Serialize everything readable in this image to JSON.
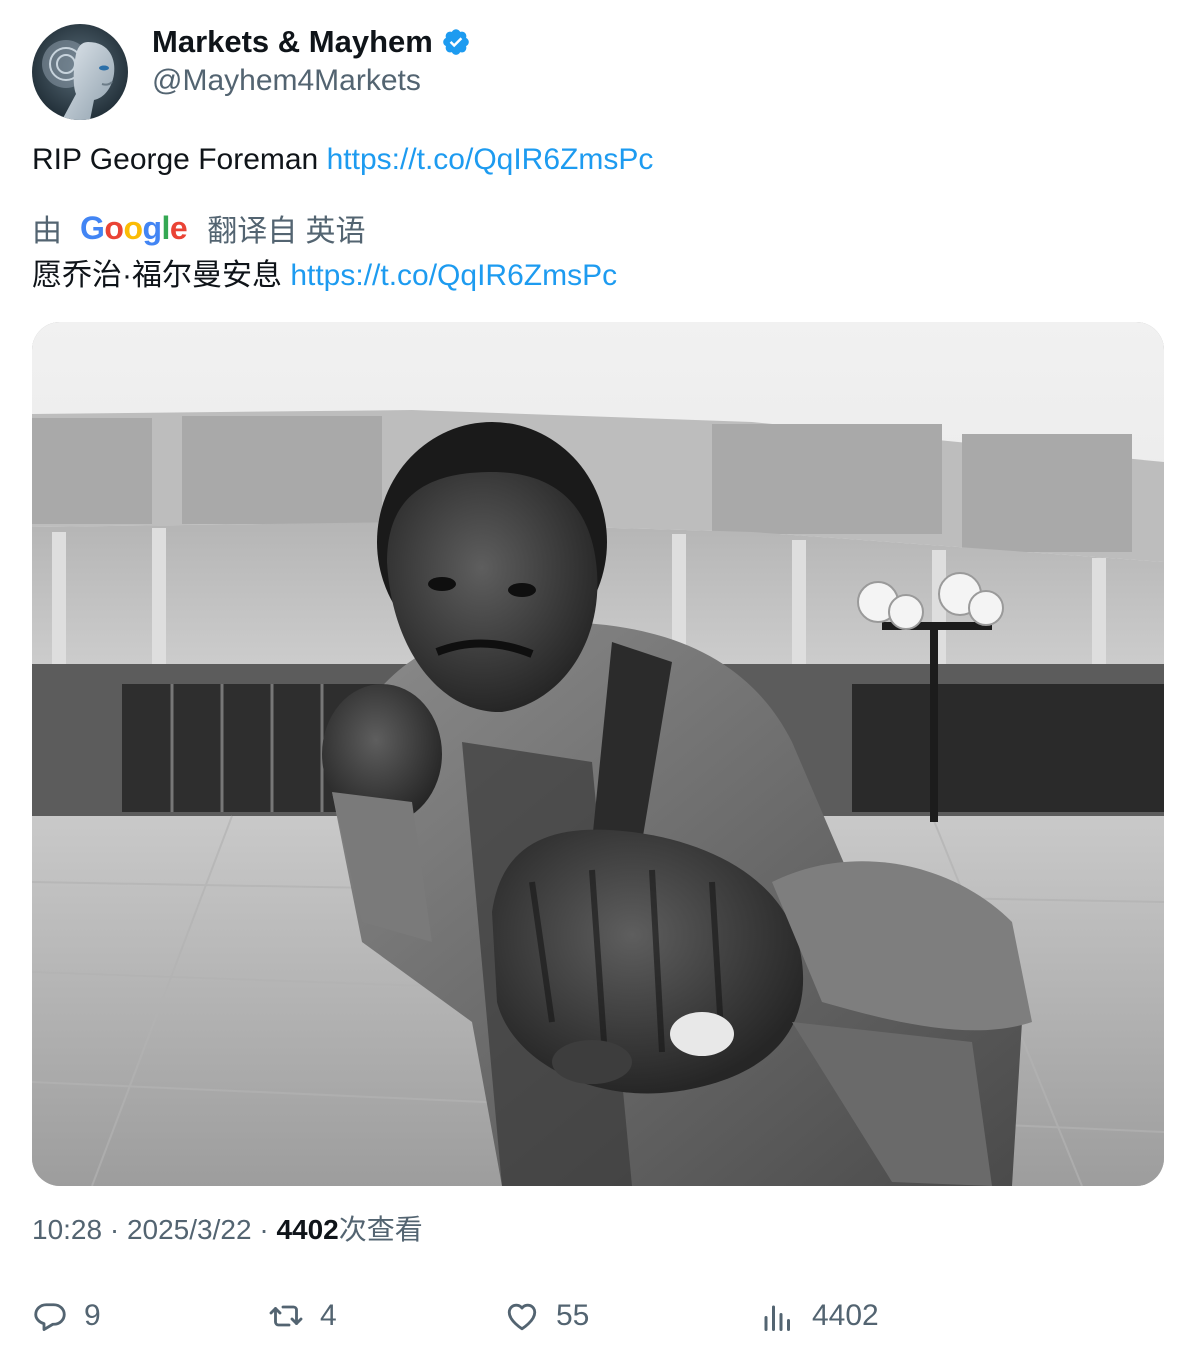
{
  "author": {
    "display_name": "Markets & Mayhem",
    "handle": "@Mayhem4Markets",
    "verified_icon": "verified-badge-icon",
    "avatar_icon": "robot-avatar"
  },
  "tweet": {
    "text": "RIP George Foreman ",
    "link": "https://t.co/QqIR6ZmsPc"
  },
  "translation": {
    "by_label": "由",
    "provider": [
      "G",
      "o",
      "o",
      "g",
      "l",
      "e"
    ],
    "from_label": "翻译自 英语",
    "text": "愿乔治·福尔曼安息 ",
    "link": "https://t.co/QqIR6ZmsPc"
  },
  "media": {
    "icon": "boxer-photo"
  },
  "meta": {
    "time": "10:28",
    "separator": " · ",
    "date": "2025/3/22",
    "views_count": "4402",
    "views_label": "次查看"
  },
  "actions": {
    "replies": "9",
    "retweets": "4",
    "likes": "55",
    "views": "4402"
  },
  "colors": {
    "link": "#1d9bf0",
    "secondary_text": "#536471",
    "verified": "#1d9bf0"
  }
}
